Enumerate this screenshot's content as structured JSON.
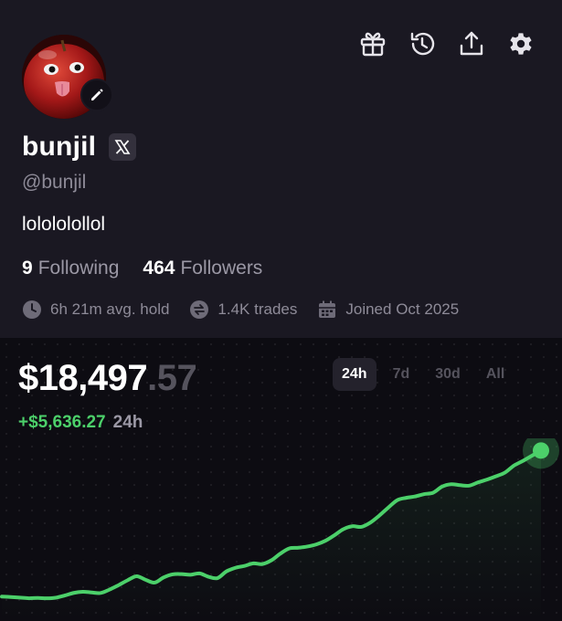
{
  "profile": {
    "name": "bunjil",
    "handle": "@bunjil",
    "bio": "lolololollol",
    "following_count": "9",
    "following_label": "Following",
    "followers_count": "464",
    "followers_label": "Followers",
    "avg_hold": "6h 21m avg. hold",
    "trades": "1.4K trades",
    "joined": "Joined Oct 2025",
    "verified_icon": "x-logo-icon",
    "avatar_icon": "apple-face-avatar"
  },
  "top_icons": [
    "gift-icon",
    "history-icon",
    "share-icon",
    "settings-icon"
  ],
  "portfolio": {
    "value_main": "$18,497",
    "value_cents": ".57",
    "change": "+$5,636.27",
    "change_period": "24h",
    "ranges": [
      "24h",
      "7d",
      "30d",
      "All"
    ],
    "active_range": "24h"
  },
  "colors": {
    "background": "#18161f",
    "chart_background": "#0d0c12",
    "accent_green": "#4cd06a",
    "muted_text": "#8e8b98"
  },
  "chart_data": {
    "type": "line",
    "title": "",
    "xlabel": "",
    "ylabel": "",
    "x": [
      0,
      1,
      2,
      3,
      4,
      5,
      6,
      7,
      8,
      9,
      10,
      11,
      12,
      13,
      14,
      15,
      16,
      17,
      18,
      19,
      20,
      21,
      22,
      23,
      24,
      25,
      26,
      27,
      28,
      29,
      30,
      31,
      32,
      33,
      34,
      35,
      36,
      37,
      38,
      39,
      40,
      41,
      42,
      43,
      44,
      45,
      46,
      47,
      48,
      49,
      50,
      51,
      52,
      53,
      54,
      55,
      56,
      57,
      58,
      59,
      60
    ],
    "values": [
      12861,
      12856,
      12850,
      12843,
      12846,
      12842,
      12849,
      12872,
      12900,
      12912,
      12905,
      12899,
      12936,
      12983,
      13035,
      13078,
      13040,
      13010,
      13065,
      13098,
      13101,
      13094,
      13108,
      13072,
      13058,
      13130,
      13168,
      13188,
      13215,
      13208,
      13248,
      13320,
      13375,
      13382,
      13395,
      13418,
      13456,
      13515,
      13580,
      13612,
      13605,
      13650,
      13725,
      13810,
      13890,
      13915,
      13930,
      13955,
      13970,
      14035,
      14060,
      14050,
      14045,
      14080,
      14110,
      14145,
      14185,
      14260,
      14310,
      14365,
      14420
    ],
    "ylim": [
      12600,
      14550
    ],
    "grid": false,
    "legend": "none",
    "series": [
      {
        "values_ref": "values",
        "color": "#4cd06a"
      }
    ]
  }
}
